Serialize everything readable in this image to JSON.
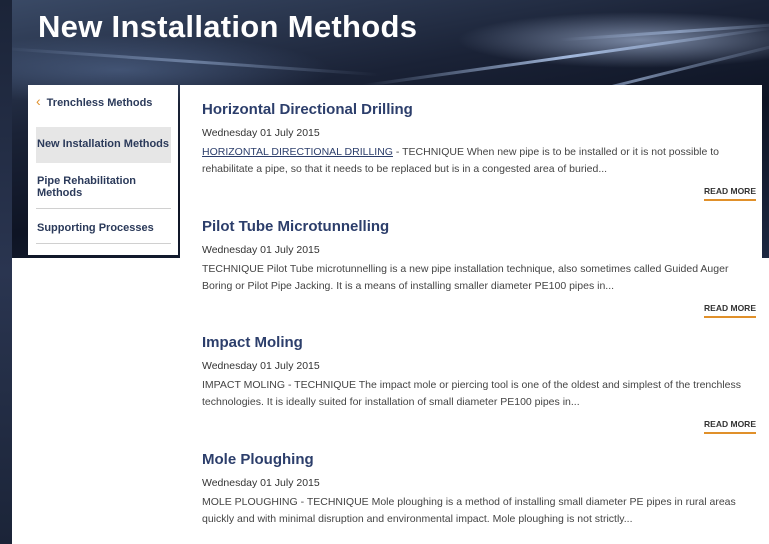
{
  "page": {
    "title": "New Installation Methods"
  },
  "sidebar": {
    "back_label": "Trenchless Methods",
    "items": [
      {
        "label": "New Installation Methods"
      },
      {
        "label": "Pipe Rehabilitation Methods"
      },
      {
        "label": "Supporting Processes"
      }
    ]
  },
  "articles": [
    {
      "title": "Horizontal Directional Drilling",
      "date": "Wednesday 01 July 2015",
      "link_text": "HORIZONTAL DIRECTIONAL DRILLING",
      "text": " - TECHNIQUE When new pipe is to be installed or it is not possible to rehabilitate a pipe, so that it needs to be replaced but is in a congested area of buried...",
      "read_more": "READ MORE"
    },
    {
      "title": "Pilot Tube Microtunnelling",
      "date": "Wednesday 01 July 2015",
      "text": "TECHNIQUE Pilot Tube microtunnelling is a new pipe installation technique, also sometimes called Guided Auger Boring or Pilot Pipe Jacking. It is a means of installing smaller diameter PE100 pipes in...",
      "read_more": "READ MORE"
    },
    {
      "title": "Impact Moling",
      "date": "Wednesday 01 July 2015",
      "text": "IMPACT MOLING - TECHNIQUE The impact mole or piercing tool is one of the oldest and simplest of the trenchless technologies. It is ideally suited for installation of small diameter PE100 pipes in...",
      "read_more": "READ MORE"
    },
    {
      "title": "Mole Ploughing",
      "date": "Wednesday 01 July 2015",
      "text": "MOLE PLOUGHING - TECHNIQUE Mole ploughing is a method of installing small diameter PE pipes in rural areas quickly and with minimal disruption and environmental impact. Mole ploughing is not strictly...",
      "read_more": ""
    }
  ],
  "colors": {
    "accent": "#e0902a",
    "title": "#2c3e6b",
    "hero_dark": "#0e1424"
  }
}
